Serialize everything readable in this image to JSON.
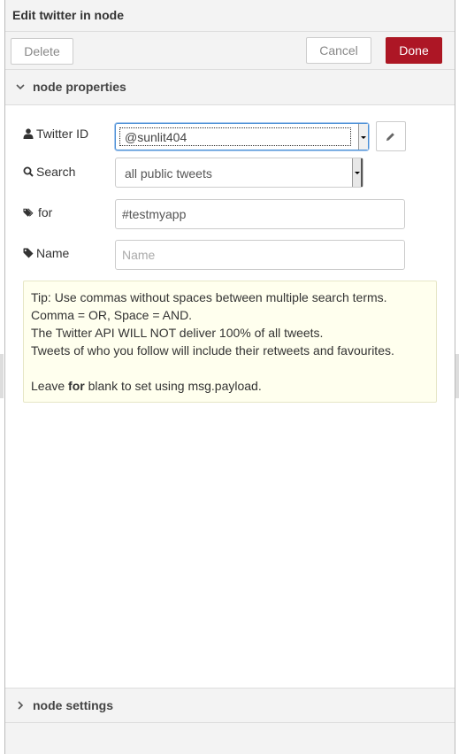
{
  "header": {
    "title": "Edit twitter in node"
  },
  "toolbar": {
    "delete_label": "Delete",
    "cancel_label": "Cancel",
    "done_label": "Done"
  },
  "sections": {
    "properties_label": "node properties",
    "settings_label": "node settings"
  },
  "form": {
    "twitter_id": {
      "label": "Twitter ID",
      "icon": "user-icon",
      "value": "@sunlit404"
    },
    "search": {
      "label": "Search",
      "icon": "search-icon",
      "value": "all public tweets"
    },
    "for": {
      "label": "for",
      "icon": "tags-icon",
      "value": "#testmyapp"
    },
    "name": {
      "label": "Name",
      "icon": "tag-icon",
      "value": "",
      "placeholder": "Name"
    }
  },
  "tip": {
    "line1": "Tip: Use commas without spaces between multiple search terms.",
    "line2": "Comma = OR, Space = AND.",
    "line3": "The Twitter API WILL NOT deliver 100% of all tweets.",
    "line4": "Tweets of who you follow will include their retweets and favourites.",
    "line5_prefix": "Leave ",
    "line5_bold": "for",
    "line5_suffix": " blank to set using msg.payload."
  },
  "colors": {
    "done_button": "#ad1625",
    "tip_background": "#ffffee",
    "header_background": "#f3f3f3"
  }
}
